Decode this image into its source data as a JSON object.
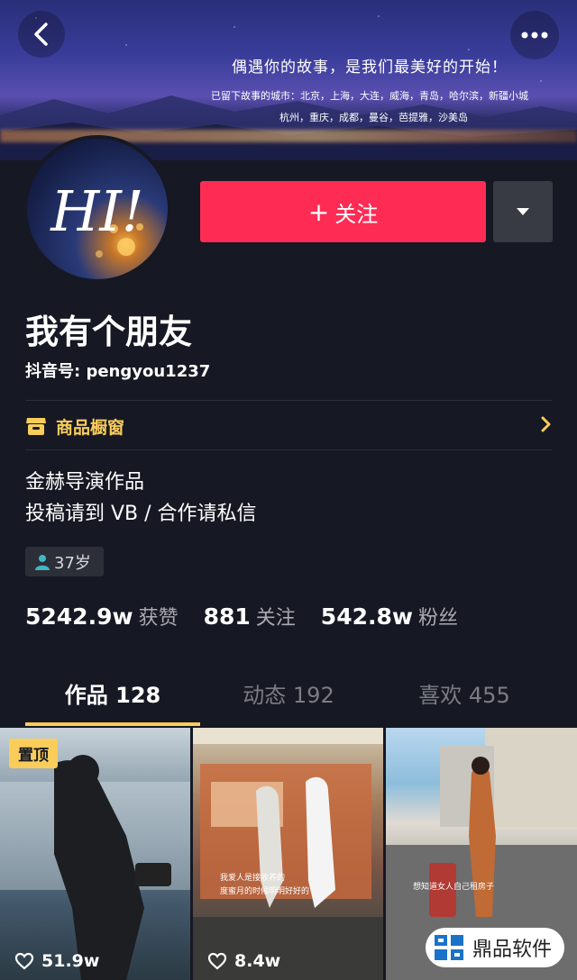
{
  "banner": {
    "slogan": "偶遇你的故事，是我们最美好的开始！",
    "cities_line1": "已留下故事的城市：北京，上海，大连，威海，青岛，哈尔滨，新疆小城",
    "cities_line2": "杭州，重庆，成都，曼谷，芭提雅，沙美岛"
  },
  "avatar": {
    "text": "HI!"
  },
  "actions": {
    "follow_label": "关注"
  },
  "profile": {
    "nickname": "我有个朋友",
    "douyin_id": "抖音号: pengyou1237",
    "shop_label": "商品橱窗",
    "bio_line1": "金赫导演作品",
    "bio_line2": "投稿请到 VB / 合作请私信",
    "age": "37岁"
  },
  "stats": [
    {
      "value": "5242.9w",
      "label": "获赞"
    },
    {
      "value": "881",
      "label": "关注"
    },
    {
      "value": "542.8w",
      "label": "粉丝"
    }
  ],
  "tabs": [
    {
      "label": "作品 128"
    },
    {
      "label": "动态 192"
    },
    {
      "label": "喜欢 455"
    }
  ],
  "videos": [
    {
      "pinned_label": "置顶",
      "likes": "51.9w",
      "caption": ""
    },
    {
      "likes": "8.4w",
      "caption_line1": "我爱人是接收养的",
      "caption_line2": "度蜜月的时候明明好好的"
    },
    {
      "likes": "",
      "caption": "想知道女人自己租房子"
    }
  ],
  "watermark": {
    "text": "鼎品软件"
  },
  "colors": {
    "accent": "#fe2c55",
    "highlight": "#facd5b",
    "background": "#161823"
  }
}
